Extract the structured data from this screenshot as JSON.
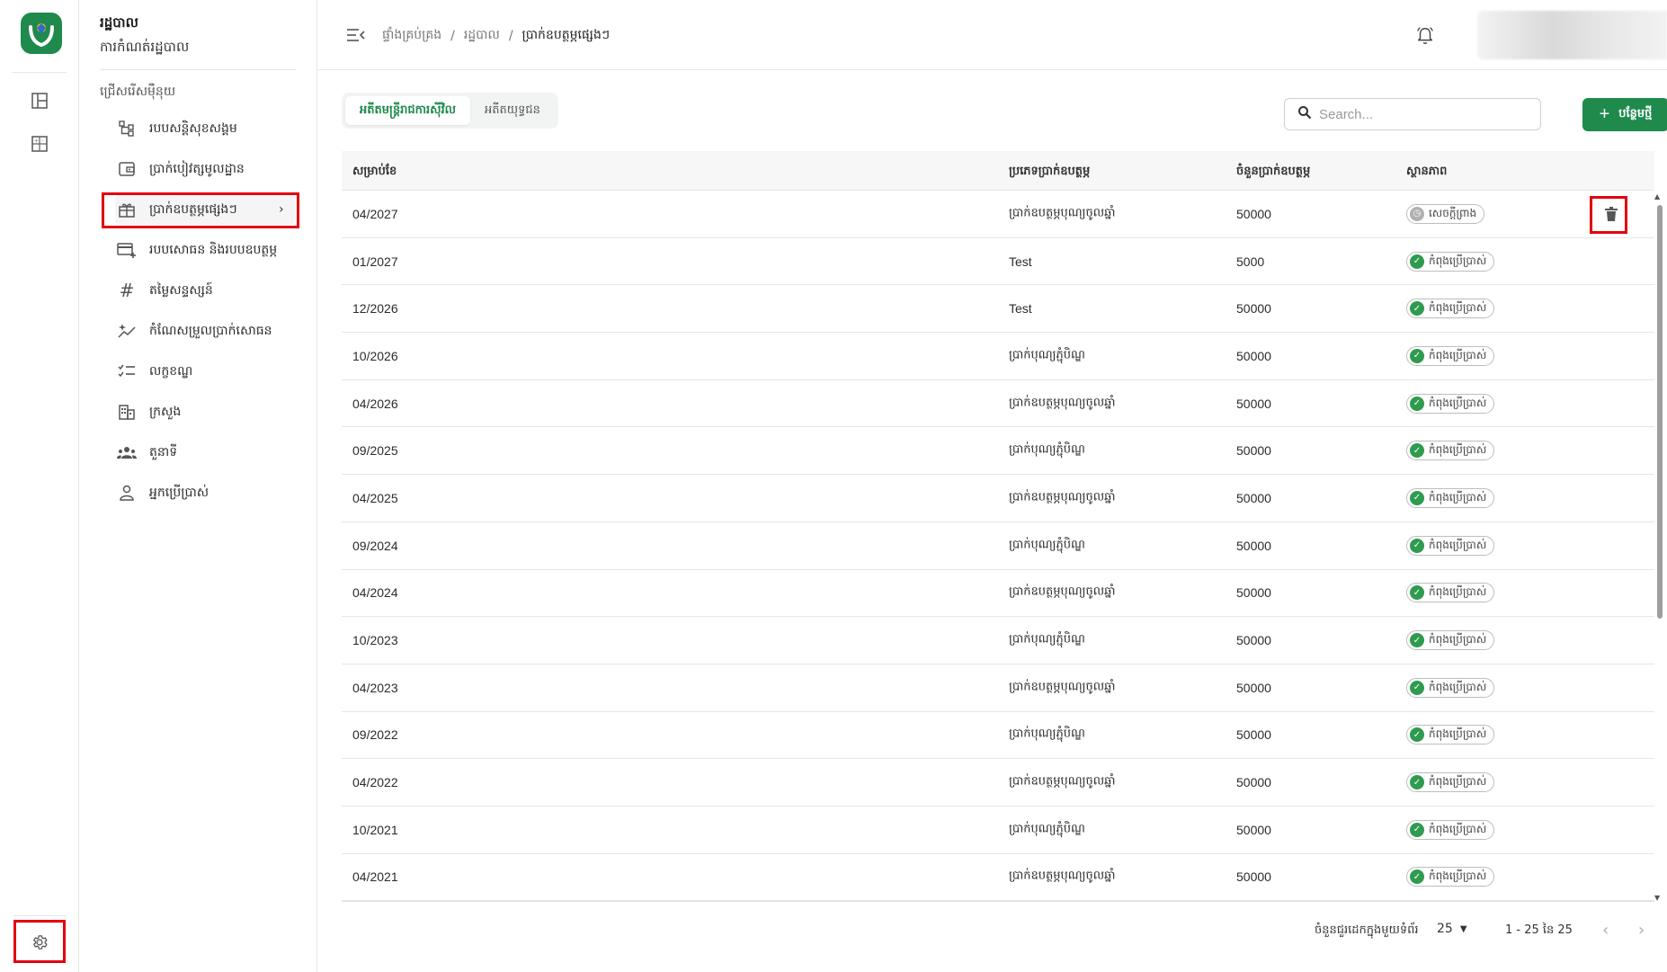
{
  "app": {
    "title": "រដ្ឋបាល",
    "subtitle": "ការកំណត់រដ្ឋបាល",
    "brand_color": "#1f8a4c"
  },
  "rail": {
    "items": [
      {
        "icon": "layout-dashboard-icon"
      },
      {
        "icon": "calculator-icon"
      }
    ],
    "settings_icon": "gear-icon"
  },
  "sidebar": {
    "section_label": "ជ្រើសរើសម៉ឺនុយ",
    "items": [
      {
        "label": "របបសន្តិសុខសង្គម",
        "icon": "hierarchy-icon"
      },
      {
        "label": "ប្រាក់បៀវត្សមូលដ្ឋាន",
        "icon": "wallet-icon"
      },
      {
        "label": "ប្រាក់ឧបត្ថម្ភផ្សេងៗ",
        "icon": "gift-icon",
        "active": true
      },
      {
        "label": "របបសោធន និងរបបឧបត្ថម្ភ",
        "icon": "card-plus-icon"
      },
      {
        "label": "តម្លៃសន្ទស្សន៍",
        "icon": "hash-icon"
      },
      {
        "label": "កំណែសម្រួលប្រាក់សោធន",
        "icon": "sparkle-chart-icon"
      },
      {
        "label": "លក្ខខណ្ឌ",
        "icon": "checklist-icon"
      },
      {
        "label": "ក្រសួង",
        "icon": "building-icon"
      },
      {
        "label": "តួនាទី",
        "icon": "group-icon"
      },
      {
        "label": "អ្នកប្រើប្រាស់",
        "icon": "person-icon"
      }
    ]
  },
  "breadcrumb": {
    "items": [
      "ផ្ទាំងគ្រប់គ្រង",
      "រដ្ឋបាល",
      "ប្រាក់ឧបត្ថម្ភផ្សេងៗ"
    ]
  },
  "tabs": [
    {
      "label": "អតីតមន្ត្រីរាជការស៊ីវិល",
      "active": true
    },
    {
      "label": "អតីតយុទ្ធជន",
      "active": false
    }
  ],
  "search": {
    "placeholder": "Search..."
  },
  "add_button": {
    "label": "បន្ថែមថ្មី"
  },
  "table": {
    "headers": [
      "សម្រាប់ខែ",
      "ប្រភេទប្រាក់ឧបត្ថម្ភ",
      "ចំនួនប្រាក់ឧបត្ថម្ភ",
      "ស្ថានភាព"
    ],
    "rows": [
      {
        "month": "04/2027",
        "type": "ប្រាក់ឧបត្ថម្ភបុណ្យចូលឆ្នាំ",
        "amount": "50000",
        "status": "សេចក្តីព្រាង",
        "status_kind": "draft"
      },
      {
        "month": "01/2027",
        "type": "Test",
        "amount": "5000",
        "status": "កំពុងប្រើប្រាស់",
        "status_kind": "active"
      },
      {
        "month": "12/2026",
        "type": "Test",
        "amount": "50000",
        "status": "កំពុងប្រើប្រាស់",
        "status_kind": "active"
      },
      {
        "month": "10/2026",
        "type": "ប្រាក់បុណ្យភ្ជុំបិណ្ឌ",
        "amount": "50000",
        "status": "កំពុងប្រើប្រាស់",
        "status_kind": "active"
      },
      {
        "month": "04/2026",
        "type": "ប្រាក់ឧបត្ថម្ភបុណ្យចូលឆ្នាំ",
        "amount": "50000",
        "status": "កំពុងប្រើប្រាស់",
        "status_kind": "active"
      },
      {
        "month": "09/2025",
        "type": "ប្រាក់បុណ្យភ្ជុំបិណ្ឌ",
        "amount": "50000",
        "status": "កំពុងប្រើប្រាស់",
        "status_kind": "active"
      },
      {
        "month": "04/2025",
        "type": "ប្រាក់ឧបត្ថម្ភបុណ្យចូលឆ្នាំ",
        "amount": "50000",
        "status": "កំពុងប្រើប្រាស់",
        "status_kind": "active"
      },
      {
        "month": "09/2024",
        "type": "ប្រាក់បុណ្យភ្ជុំបិណ្ឌ",
        "amount": "50000",
        "status": "កំពុងប្រើប្រាស់",
        "status_kind": "active"
      },
      {
        "month": "04/2024",
        "type": "ប្រាក់ឧបត្ថម្ភបុណ្យចូលឆ្នាំ",
        "amount": "50000",
        "status": "កំពុងប្រើប្រាស់",
        "status_kind": "active"
      },
      {
        "month": "10/2023",
        "type": "ប្រាក់បុណ្យភ្ជុំបិណ្ឌ",
        "amount": "50000",
        "status": "កំពុងប្រើប្រាស់",
        "status_kind": "active"
      },
      {
        "month": "04/2023",
        "type": "ប្រាក់ឧបត្ថម្ភបុណ្យចូលឆ្នាំ",
        "amount": "50000",
        "status": "កំពុងប្រើប្រាស់",
        "status_kind": "active"
      },
      {
        "month": "09/2022",
        "type": "ប្រាក់បុណ្យភ្ជុំបិណ្ឌ",
        "amount": "50000",
        "status": "កំពុងប្រើប្រាស់",
        "status_kind": "active"
      },
      {
        "month": "04/2022",
        "type": "ប្រាក់ឧបត្ថម្ភបុណ្យចូលឆ្នាំ",
        "amount": "50000",
        "status": "កំពុងប្រើប្រាស់",
        "status_kind": "active"
      },
      {
        "month": "10/2021",
        "type": "ប្រាក់បុណ្យភ្ជុំបិណ្ឌ",
        "amount": "50000",
        "status": "កំពុងប្រើប្រាស់",
        "status_kind": "active"
      },
      {
        "month": "04/2021",
        "type": "ប្រាក់ឧបត្ថម្ភបុណ្យចូលឆ្នាំ",
        "amount": "50000",
        "status": "កំពុងប្រើប្រាស់",
        "status_kind": "active"
      }
    ]
  },
  "pagination": {
    "rows_per_page_label": "ចំនួនជួរដេកក្នុងមួយទំព័រ",
    "rows_per_page": "25",
    "range": "1 - 25 នៃ 25"
  }
}
